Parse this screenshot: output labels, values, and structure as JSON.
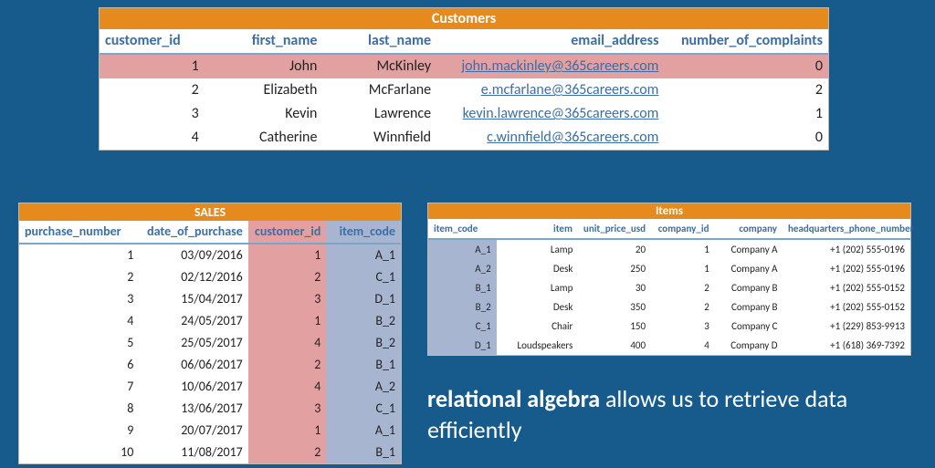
{
  "customers": {
    "title": "Customers",
    "headers": [
      "customer_id",
      "first_name",
      "last_name",
      "email_address",
      "number_of_complaints"
    ],
    "rows": [
      {
        "id": "1",
        "first": "John",
        "last": "McKinley",
        "email": "john.mackinley@365careers.com",
        "complaints": "0",
        "hl": true
      },
      {
        "id": "2",
        "first": "Elizabeth",
        "last": "McFarlane",
        "email": "e.mcfarlane@365careers.com",
        "complaints": "2",
        "hl": false
      },
      {
        "id": "3",
        "first": "Kevin",
        "last": "Lawrence",
        "email": "kevin.lawrence@365careers.com",
        "complaints": "1",
        "hl": false
      },
      {
        "id": "4",
        "first": "Catherine",
        "last": "Winnfield",
        "email": "c.winnfield@365careers.com",
        "complaints": "0",
        "hl": false
      }
    ]
  },
  "sales": {
    "title": "SALES",
    "headers": [
      "purchase_number",
      "date_of_purchase",
      "customer_id",
      "item_code"
    ],
    "rows": [
      {
        "num": "1",
        "date": "03/09/2016",
        "cust": "1",
        "item": "A_1"
      },
      {
        "num": "2",
        "date": "02/12/2016",
        "cust": "2",
        "item": "C_1"
      },
      {
        "num": "3",
        "date": "15/04/2017",
        "cust": "3",
        "item": "D_1"
      },
      {
        "num": "4",
        "date": "24/05/2017",
        "cust": "1",
        "item": "B_2"
      },
      {
        "num": "5",
        "date": "25/05/2017",
        "cust": "4",
        "item": "B_2"
      },
      {
        "num": "6",
        "date": "06/06/2017",
        "cust": "2",
        "item": "B_1"
      },
      {
        "num": "7",
        "date": "10/06/2017",
        "cust": "4",
        "item": "A_2"
      },
      {
        "num": "8",
        "date": "13/06/2017",
        "cust": "3",
        "item": "C_1"
      },
      {
        "num": "9",
        "date": "20/07/2017",
        "cust": "1",
        "item": "A_1"
      },
      {
        "num": "10",
        "date": "11/08/2017",
        "cust": "2",
        "item": "B_1"
      }
    ]
  },
  "items": {
    "title": "Items",
    "headers": [
      "item_code",
      "item",
      "unit_price_usd",
      "company_id",
      "company",
      "headquarters_phone_number"
    ],
    "rows": [
      {
        "code": "A_1",
        "item": "Lamp",
        "price": "20",
        "cid": "1",
        "company": "Company A",
        "phone": "+1 (202) 555-0196"
      },
      {
        "code": "A_2",
        "item": "Desk",
        "price": "250",
        "cid": "1",
        "company": "Company A",
        "phone": "+1 (202) 555-0196"
      },
      {
        "code": "B_1",
        "item": "Lamp",
        "price": "30",
        "cid": "2",
        "company": "Company B",
        "phone": "+1 (202) 555-0152"
      },
      {
        "code": "B_2",
        "item": "Desk",
        "price": "350",
        "cid": "2",
        "company": "Company B",
        "phone": "+1 (202) 555-0152"
      },
      {
        "code": "C_1",
        "item": "Chair",
        "price": "150",
        "cid": "3",
        "company": "Company C",
        "phone": "+1 (229) 853-9913"
      },
      {
        "code": "D_1",
        "item": "Loudspeakers",
        "price": "400",
        "cid": "4",
        "company": "Company D",
        "phone": "+1 (618) 369-7392"
      }
    ]
  },
  "caption": {
    "bold": "relational algebra",
    "rest": " allows us to retrieve data efficiently"
  }
}
